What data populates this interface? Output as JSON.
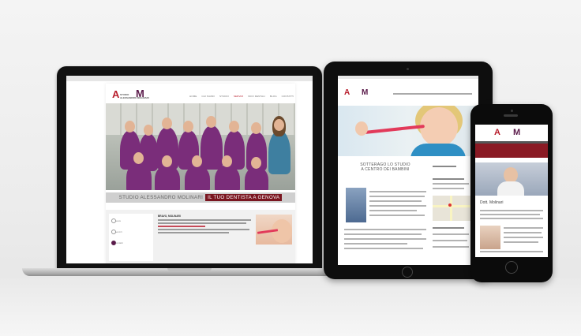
{
  "laptop": {
    "logo_letters": "A",
    "logo_m": "M",
    "logo_sub_1": "STUDIO",
    "logo_sub_2": "ALESSANDRO MOLINARI",
    "nav": [
      "HOME",
      "CHI SIAMO",
      "STUDIO",
      "SERVIZI",
      "INFO DENTALI",
      "BLOG",
      "CONTATTI"
    ],
    "banner_grey": "STUDIO ALESSANDRO MOLINARI",
    "banner_red": "IL TUO DENTISTA A GENOVA",
    "lower_title": "BRAVO, MOLINARI",
    "side_links": [
      "news",
      "servizi",
      "contatti"
    ]
  },
  "tablet": {
    "heading_line1": "SOTTERAGO LO STUDIO",
    "heading_line2": "A CENTRO DEI BAMBINI"
  },
  "phone": {
    "title": "Dott. Molinari"
  },
  "colors": {
    "brand_red": "#b81e2d",
    "brand_purple": "#5a1a4a",
    "scrub_purple": "#7a2d7a",
    "banner_dark_red": "#7a1620"
  }
}
